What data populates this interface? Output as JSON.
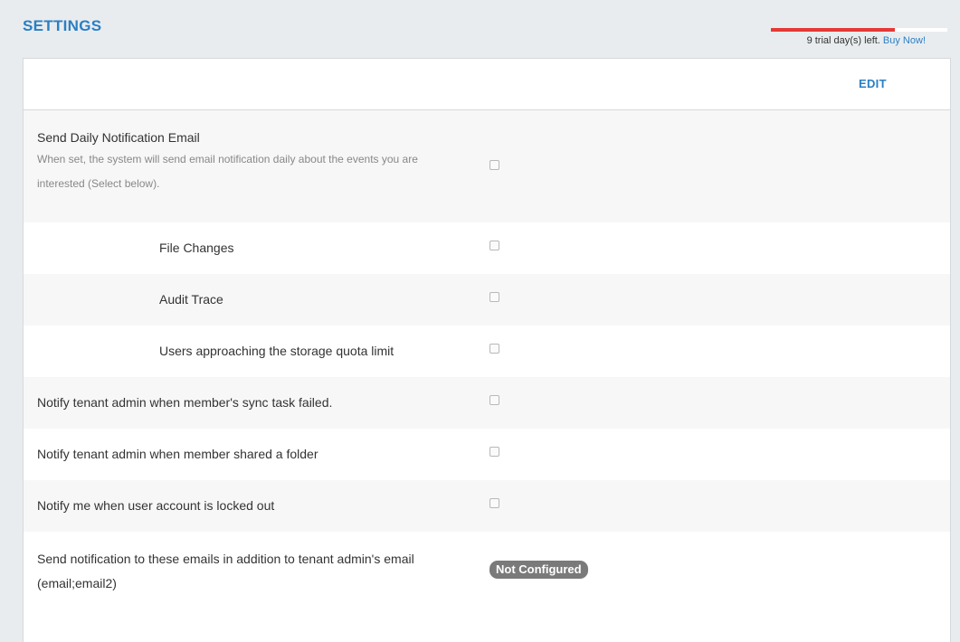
{
  "header": {
    "title": "SETTINGS",
    "trial": {
      "progress": 0.7,
      "text": "9 trial day(s) left. ",
      "buy_label": "Buy Now!"
    }
  },
  "card": {
    "edit_label": "EDIT",
    "daily": {
      "label": "Send Daily Notification Email",
      "description": "When set, the system will send email notification daily about the events you are interested (Select below)."
    },
    "sub_items": [
      {
        "label": "File Changes"
      },
      {
        "label": "Audit Trace"
      },
      {
        "label": "Users approaching the storage quota limit"
      }
    ],
    "items": [
      {
        "label": "Notify tenant admin when member's sync task failed."
      },
      {
        "label": "Notify tenant admin when member shared a folder"
      },
      {
        "label": "Notify me when user account is locked out"
      }
    ],
    "extra_emails": {
      "label": "Send notification to these emails in addition to tenant admin's email (email;email2)",
      "status": "Not Configured"
    }
  }
}
